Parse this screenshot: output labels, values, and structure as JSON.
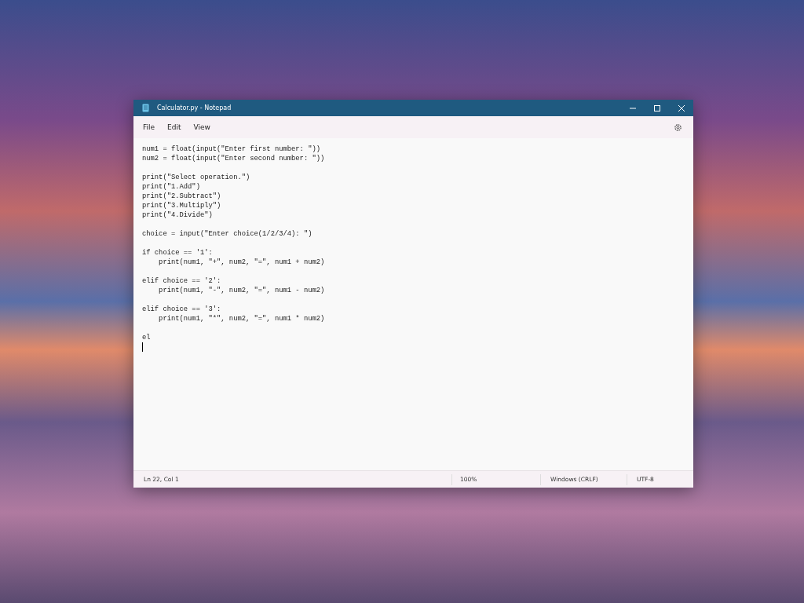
{
  "window": {
    "title": "Calculator.py - Notepad"
  },
  "menu": [
    "File",
    "Edit",
    "View"
  ],
  "editor": {
    "blocks": [
      [
        "num1 = float(input(\"Enter first number: \"))",
        "num2 = float(input(\"Enter second number: \"))"
      ],
      [
        "print(\"Select operation.\")",
        "print(\"1.Add\")",
        "print(\"2.Subtract\")",
        "print(\"3.Multiply\")",
        "print(\"4.Divide\")"
      ],
      [
        "choice = input(\"Enter choice(1/2/3/4): \")"
      ],
      [
        "if choice == '1':",
        "    print(num1, \"+\", num2, \"=\", num1 + num2)"
      ],
      [
        "elif choice == '2':",
        "    print(num1, \"-\", num2, \"=\", num1 - num2)"
      ],
      [
        "elif choice == '3':",
        "    print(num1, \"*\", num2, \"=\", num1 * num2)"
      ],
      [
        "el"
      ]
    ]
  },
  "status_bar": {
    "position": "Ln 22, Col 1",
    "zoom": "100%",
    "line_ending": "Windows (CRLF)",
    "encoding": "UTF-8"
  }
}
